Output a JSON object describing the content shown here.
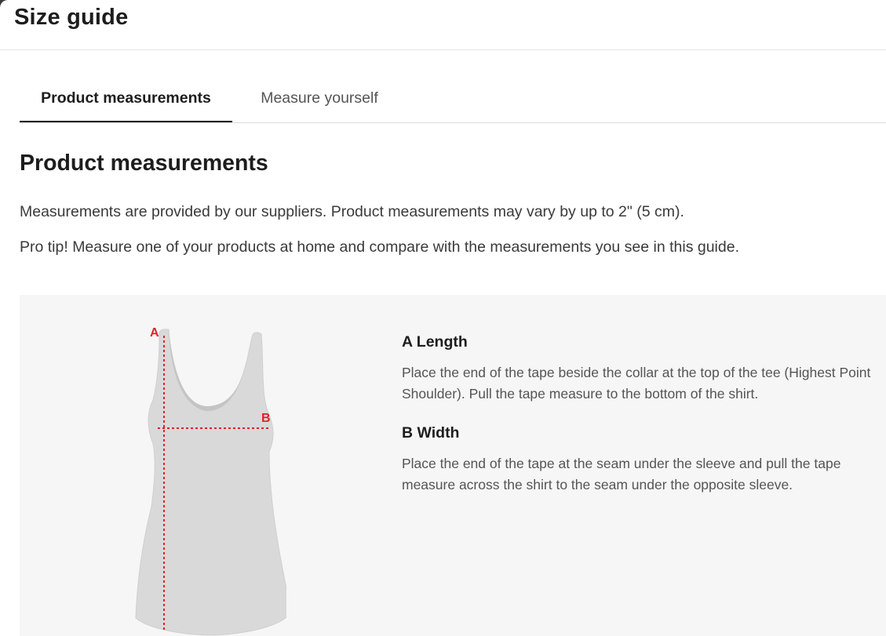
{
  "modal": {
    "title": "Size guide"
  },
  "tabs": [
    {
      "label": "Product measurements",
      "active": true
    },
    {
      "label": "Measure yourself",
      "active": false
    }
  ],
  "section": {
    "heading": "Product measurements",
    "paragraphs": [
      "Measurements are provided by our suppliers. Product measurements may vary by up to 2\" (5 cm).",
      "Pro tip! Measure one of your products at home and compare with the measurements you see in this guide."
    ]
  },
  "diagram": {
    "marker_a": "A",
    "marker_b": "B",
    "marker_color": "#e0202a",
    "garment_color": "#d9d9d9"
  },
  "measurements": [
    {
      "title": "A Length",
      "description": "Place the end of the tape beside the collar at the top of the tee (Highest Point Shoulder). Pull the tape measure to the bottom of the shirt."
    },
    {
      "title": "B Width",
      "description": "Place the end of the tape at the seam under the sleeve and pull the tape measure across the shirt to the seam under the opposite sleeve."
    }
  ]
}
